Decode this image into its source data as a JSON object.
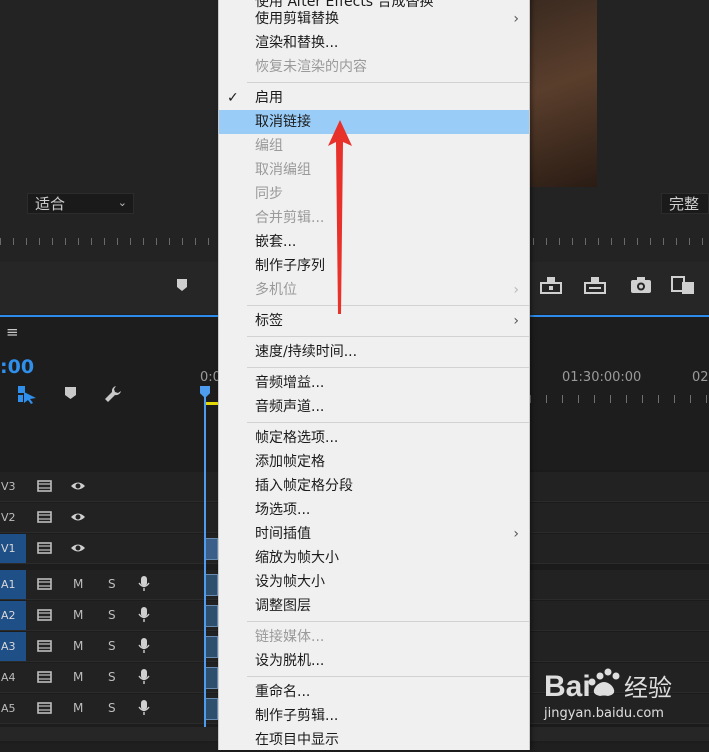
{
  "monitor": {
    "fit_label": "适合",
    "quality_label": "完整"
  },
  "timeline": {
    "panel_menu_glyph": "≡",
    "timecode": ":00",
    "ruler_labels": [
      "0:0",
      "01:30:00:00",
      "02"
    ],
    "video_tracks": [
      {
        "name": "V3"
      },
      {
        "name": "V2"
      },
      {
        "name": "V1"
      }
    ],
    "audio_tracks": [
      {
        "name": "A1",
        "m": "M",
        "s": "S"
      },
      {
        "name": "A2",
        "m": "M",
        "s": "S"
      },
      {
        "name": "A3",
        "m": "M",
        "s": "S"
      },
      {
        "name": "A4",
        "m": "M",
        "s": "S"
      },
      {
        "name": "A5",
        "m": "M",
        "s": "S"
      }
    ]
  },
  "context_menu": {
    "items": [
      {
        "label": "使用 After Effects 合成替换",
        "disabled": false
      },
      {
        "label": "使用剪辑替换",
        "disabled": false,
        "submenu": true
      },
      {
        "label": "渲染和替换...",
        "disabled": false
      },
      {
        "label": "恢复未渲染的内容",
        "disabled": true
      },
      {
        "label": "启用",
        "disabled": false,
        "checked": true
      },
      {
        "label": "取消链接",
        "disabled": false,
        "highlighted": true
      },
      {
        "label": "编组",
        "disabled": true
      },
      {
        "label": "取消编组",
        "disabled": true
      },
      {
        "label": "同步",
        "disabled": true
      },
      {
        "label": "合并剪辑...",
        "disabled": true
      },
      {
        "label": "嵌套...",
        "disabled": false
      },
      {
        "label": "制作子序列",
        "disabled": false
      },
      {
        "label": "多机位",
        "disabled": true,
        "submenu": true
      },
      {
        "label": "标签",
        "disabled": false,
        "submenu": true
      },
      {
        "label": "速度/持续时间...",
        "disabled": false
      },
      {
        "label": "音频增益...",
        "disabled": false
      },
      {
        "label": "音频声道...",
        "disabled": false
      },
      {
        "label": "帧定格选项...",
        "disabled": false
      },
      {
        "label": "添加帧定格",
        "disabled": false
      },
      {
        "label": "插入帧定格分段",
        "disabled": false
      },
      {
        "label": "场选项...",
        "disabled": false
      },
      {
        "label": "时间插值",
        "disabled": false,
        "submenu": true
      },
      {
        "label": "缩放为帧大小",
        "disabled": false
      },
      {
        "label": "设为帧大小",
        "disabled": false
      },
      {
        "label": "调整图层",
        "disabled": false
      },
      {
        "label": "链接媒体...",
        "disabled": true
      },
      {
        "label": "设为脱机...",
        "disabled": false
      },
      {
        "label": "重命名...",
        "disabled": false
      },
      {
        "label": "制作子剪辑...",
        "disabled": false
      },
      {
        "label": "在项目中显示",
        "disabled": false
      }
    ],
    "check_glyph": "✓",
    "arrow_glyph": "›"
  },
  "watermark": {
    "logo_text": "Bai",
    "logo_text2": "经验",
    "url": "jingyan.baidu.com"
  },
  "colors": {
    "menu_bg": "#f0f0f0",
    "menu_highlight": "#99ccf7",
    "accent_blue": "#2f8fea",
    "annotation_red": "#e8312a"
  }
}
